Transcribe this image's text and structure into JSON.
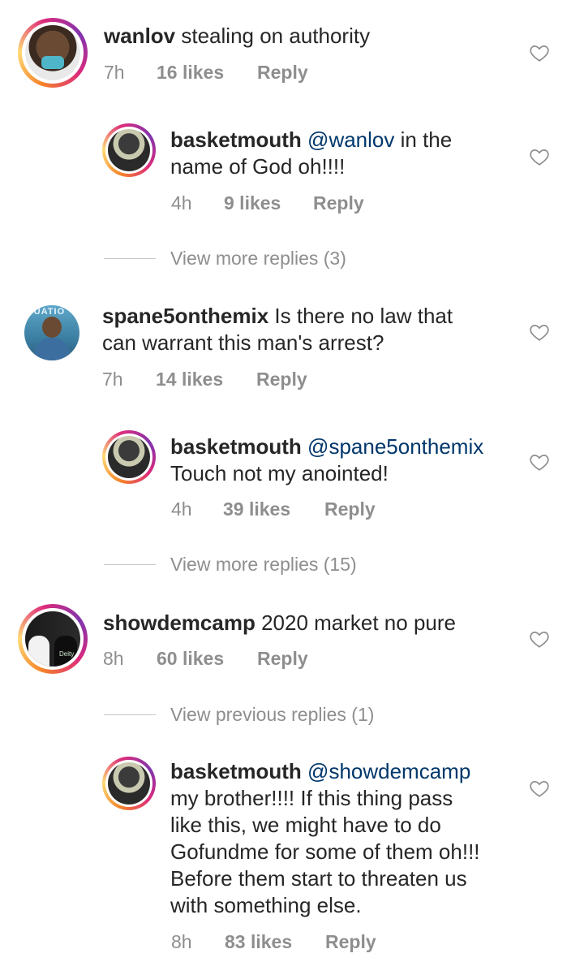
{
  "comments": [
    {
      "username": "wanlov",
      "text": "stealing on authority",
      "time": "7h",
      "likes": "16 likes",
      "reply": "Reply"
    },
    {
      "username": "basketmouth",
      "mention": "@wanlov",
      "text_line1_rest": "in the",
      "text_line2": "name of God oh!!!!",
      "time": "4h",
      "likes": "9 likes",
      "reply": "Reply"
    },
    {
      "view_more": "View more replies (3)"
    },
    {
      "username": "spane5onthemix",
      "text_line1_rest": "Is there no law that",
      "text_line2": "can warrant this man's arrest?",
      "time": "7h",
      "likes": "14 likes",
      "reply": "Reply"
    },
    {
      "username": "basketmouth",
      "mention": "@spane5onthemix",
      "text_line2": "Touch not my anointed!",
      "time": "4h",
      "likes": "39 likes",
      "reply": "Reply"
    },
    {
      "view_more": "View more replies (15)"
    },
    {
      "username": "showdemcamp",
      "text": "2020 market no pure",
      "time": "8h",
      "likes": "60 likes",
      "reply": "Reply"
    },
    {
      "view_more": "View previous replies (1)"
    },
    {
      "username": "basketmouth",
      "mention": "@showdemcamp",
      "lines": [
        "my brother!!!! If this thing pass",
        "like this, we might have to do",
        "Gofundme for some of them oh!!!",
        "Before them start to threaten us",
        "with something else."
      ],
      "time": "8h",
      "likes": "83 likes",
      "reply": "Reply"
    }
  ],
  "avatar_badge_text": "Deity",
  "avatar_spane_text": "TUATIO",
  "icons": {
    "like": "heart-outline-icon"
  },
  "colors": {
    "text": "#262626",
    "meta": "#8e8e8e",
    "mention": "#00376b"
  }
}
